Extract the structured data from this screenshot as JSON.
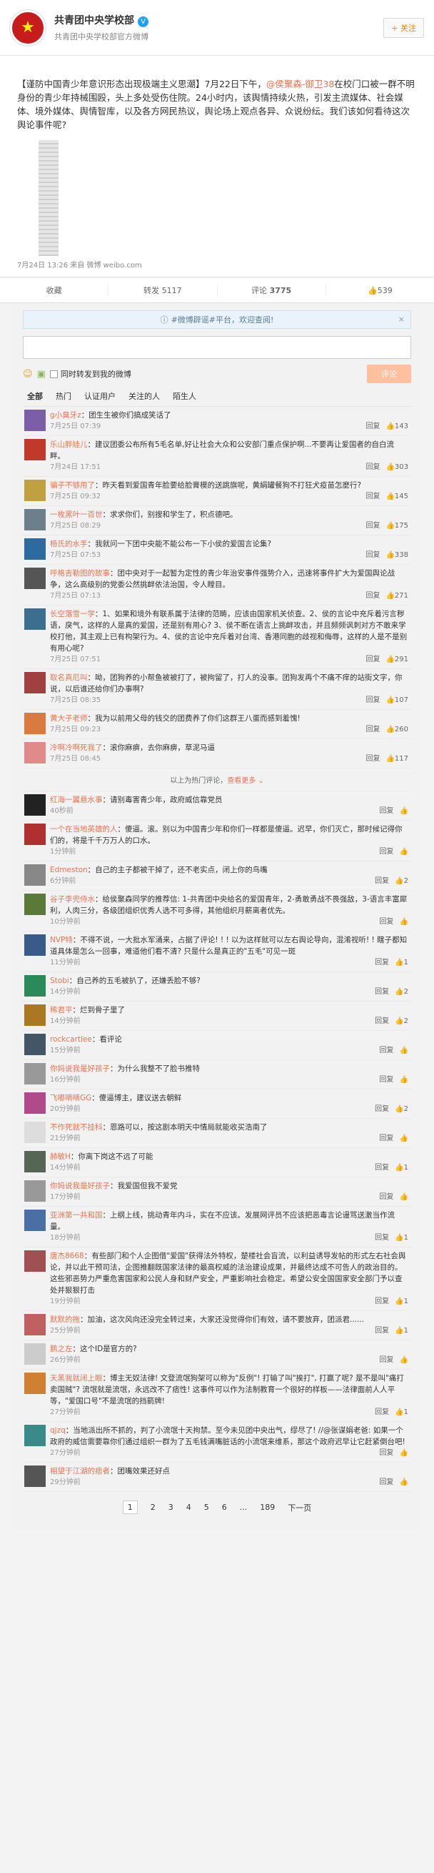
{
  "header": {
    "name": "共青团中央学校部",
    "desc": "共青团中央学校部官方微博",
    "follow": "+ 关注",
    "verified": "V"
  },
  "post": {
    "text_before": "【谨防中国青少年意识形态出现极端主义思潮】7月22日下午，",
    "mention": "@侯聚森-御卫38",
    "text_after": "在校门口被一群不明身份的青少年持械围殴，头上多处受伤住院。24小时内，该舆情持续火热，引发主流媒体、社会媒体、境外媒体、舆情智库，以及各方网民热议，舆论场上观点各异、众说纷纭。我们该如何看待这次舆论事件呢?",
    "meta": "7月24日 13:26 来自 微博 weibo.com"
  },
  "actions": {
    "fav": "收藏",
    "repost": "转发 5117",
    "comment": "评论",
    "comment_count": "3775",
    "like": "539"
  },
  "compose": {
    "notice": "#微博辟谣#平台，欢迎查阅!",
    "close": "×",
    "sync": "同时转发到我的微博",
    "submit": "评论"
  },
  "filters": [
    "全部",
    "热门",
    "认证用户",
    "关注的人",
    "陌生人"
  ],
  "ops": {
    "reply": "回复"
  },
  "hot_comments": [
    {
      "name": "g小臭牙z",
      "text": "：团生生被你们搞成笑话了",
      "time": "7月25日 07:39",
      "likes": "143",
      "color": "#7b5ea7"
    },
    {
      "name": "乐山胖娃儿",
      "text": "：建议团委公布所有5毛名单,好让社会大众和公安部门重点保护啊...不要再让爱国者的自白流畔。",
      "time": "7月24日 17:51",
      "likes": "303",
      "color": "#c0392b"
    },
    {
      "name": "骗子不够用了",
      "text": "：昨天看到爱国青年脸要给脸膏模的送跳旗呢，黄絹罐餐狗不打狂犬疫苗怎麼行?",
      "time": "7月25日 09:32",
      "likes": "145",
      "color": "#c0a040"
    },
    {
      "name": "一枚黑叶一百世",
      "text": "：求求你们，别搜和学生了，积点德吧。",
      "time": "7月25日 08:29",
      "likes": "175",
      "color": "#6d7f8a"
    },
    {
      "name": "杨氏的水手",
      "text": "：我就问一下团中央能不能公布一下小侯的爱国言论集?",
      "time": "7月25日 07:53",
      "likes": "338",
      "color": "#2d6a9f"
    },
    {
      "name": "呼格吉勒图的故事",
      "text": "：团中央对于一起暂为定性的青少年治安事件强势介入，迅速将事件扩大为爱国舆论战争，这么高级别的党委公然挑衅依法治国，令人瞠目。",
      "time": "7月25日 07:13",
      "likes": "271",
      "color": "#555555"
    },
    {
      "name": "长空落雪一学",
      "text": "：1、如果和境外有联系属于法律的范畴，应该由国家机关侦查。2、侯的言论中充斥着污言秽语，戾气，这样的人是真的爱国，还是别有用心? 3、侯不断在语言上挑衅攻击，并且频频讽刺对方不敢来学校打他，其主观上已有构架行为。4、侯的言论中充斥着对台湾、香港同胞的歧视和侮辱，这样的人是不是别有用心呢?",
      "time": "7月25日 07:51",
      "likes": "291",
      "color": "#3b6e8f"
    },
    {
      "name": "取名真厄叫",
      "text": "：呦，团狗养的小帮鱼被被打了，被拘留了，打人的没事。团狗发再个不痛不痒的站街文字，你说，以后谁还给你们办事啊?",
      "time": "7月25日 08:35",
      "likes": "107",
      "color": "#a04040"
    },
    {
      "name": "黄大子老师",
      "text": "：我为以前用父母的钱交的团费养了你们这群王八蛋而感到羞愧!",
      "time": "7月25日 09:23",
      "likes": "260",
      "color": "#d97a40"
    },
    {
      "name": "冷啊冷啊死我了",
      "text": "：滚你麻痹，去你麻痹，草泥马逼",
      "time": "7月25日 08:45",
      "likes": "117",
      "color": "#e08a8a"
    }
  ],
  "more": {
    "text": "以上为热门评论，",
    "link": "查看更多"
  },
  "comments": [
    {
      "name": "红海一翼悬水事",
      "text": "：请别毒害青少年，政府威信靠党员",
      "time": "40秒前",
      "likes": "",
      "color": "#222"
    },
    {
      "name": "一个在当地英雄的人",
      "text": "：傻逼。滚。别以为中国青少年和你们一样都是傻逼。迟早，你们灭亡，那时候记得你们的，将是千千万万人的口水。",
      "time": "1分钟前",
      "likes": "",
      "color": "#b03030"
    },
    {
      "name": "Edmeston",
      "text": "：自己的主子都被干掉了，还不老实点，闭上你的鸟嘴",
      "time": "6分钟前",
      "likes": "2",
      "color": "#888"
    },
    {
      "name": "谷子李兜侍水",
      "text": "：给侯聚森同学的推荐信: 1-共青团中央给名的爱国青年，2-勇敢勇战不畏强敌，3-语言丰富犀利，人肉三分，各级团组织优秀人选不可多得，其他组织月薪离者优先。",
      "time": "10分钟前",
      "likes": "",
      "color": "#5a7a3a"
    },
    {
      "name": "NVP特",
      "text": "：不得不说，一大批水军涌来，占据了评论! ! ! 以为这样就可以左右舆论导向，混淆视听! ! 瞎子都知道具体是怎么一回事，难道他们看不清? 只是什么是真正的\"五毛\"可见一斑",
      "time": "11分钟前",
      "likes": "1",
      "color": "#3a5a8a"
    },
    {
      "name": "Stobi",
      "text": "：自己养的五毛被扒了，还嫌丢脸不够?",
      "time": "14分钟前",
      "likes": "2",
      "color": "#2a8a5a"
    },
    {
      "name": "稀君平",
      "text": "：烂到骨子里了",
      "time": "14分钟前",
      "likes": "2",
      "color": "#aa7722"
    },
    {
      "name": "rockcartlee",
      "text": "：看评论",
      "time": "15分钟前",
      "likes": "",
      "color": "#445566"
    },
    {
      "name": "你妈说我是好孩子",
      "text": "：为什么我整不了脸书推特",
      "time": "16分钟前",
      "likes": "",
      "color": "#999"
    },
    {
      "name": "飞嘟嘀嘀GG",
      "text": "：傻逼博主，建议送去朝鲜",
      "time": "20分钟前",
      "likes": "2",
      "color": "#b04a8a"
    },
    {
      "name": "不作死就不挂科",
      "text": "：恩路可以，按这剧本明天中情局就能收买浩南了",
      "time": "21分钟前",
      "likes": "",
      "color": "#ddd"
    },
    {
      "name": "赫敏H",
      "text": "：你离下岗这不远了可能",
      "time": "14分钟前",
      "likes": "1",
      "color": "#556655"
    },
    {
      "name": "你妈说我是好孩子",
      "text": "：我爱国但我不爱党",
      "time": "17分钟前",
      "likes": "",
      "color": "#999"
    },
    {
      "name": "亚洲第一共和国",
      "text": "：上纲上线，挑动青年内斗，实在不应该。发展网评员不应该把恶毒言论谩骂送激当作流量。",
      "time": "18分钟前",
      "likes": "1",
      "color": "#4a6fa5"
    },
    {
      "name": "唐杰8668",
      "text": "：有些部门和个人企图借\"爱国\"获得法外特权，楚楼社会盲流，以利益诱导发帖的形式左右社会舆论，并以此干预司法，企图推翻既国家法律的最高权威的法治建设成果，并最终达成不可告人的政治目的。这些邪恶势力严重危害国家和公民人身和财产安全，严重影响社会稳定。希望公安全国国家安全部门予以查处并狠狠打击",
      "time": "19分钟前",
      "likes": "1",
      "color": "#a05050"
    },
    {
      "name": "默默的拖",
      "text": "：加油，这次风向还没完全转过来，大家还没觉得你们有效，请不要放弃，团派君......",
      "time": "25分钟前",
      "likes": "1",
      "color": "#c06060"
    },
    {
      "name": "鹏之左",
      "text": "：这个ID是官方的?",
      "time": "26分钟前",
      "likes": "",
      "color": "#ccc"
    },
    {
      "name": "天黑我就闭上眼",
      "text": "：博主无奴法律! 文登流氓狗架可以称为\"反例\"! 打输了叫\"挨打\", 打赢了呢? 是不是叫\"痛打卖国贼\"? 流氓就是流氓，永远改不了痞性! 这事件可以作为法制教育一个很好的样板——法律面前人人平等，\"爱国口号\"不是流氓的挡箭牌!",
      "time": "27分钟前",
      "likes": "1",
      "color": "#d08030"
    },
    {
      "name": "qjzq",
      "text": "：当地派出所不抓的，判了小流氓十天拘禁。至今未见团中央出气，缪尽了! //@张谋娟老爸: 如果一个政府的威信需要靠你们通过组织一群为了五毛钱满嘴脏话的小流氓来维系，那这个政府迟早让它赶紧倒台吧!",
      "time": "27分钟前",
      "likes": "",
      "color": "#3a8a8a"
    },
    {
      "name": "相望于江湖的痞者",
      "text": "：团嘴效果还好点",
      "time": "29分钟前",
      "likes": "",
      "color": "#555"
    }
  ],
  "pager": {
    "pages": [
      "1",
      "2",
      "3",
      "4",
      "5",
      "6",
      "...",
      "189"
    ],
    "next": "下一页"
  }
}
